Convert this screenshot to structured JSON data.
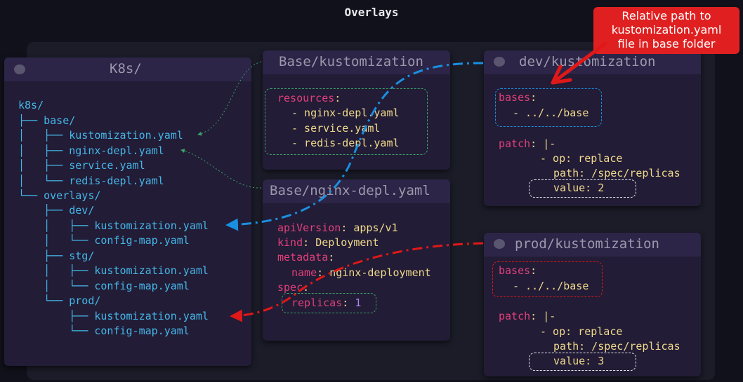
{
  "title": "Overlays",
  "callout": [
    "Relative path to",
    "kustomization.yaml",
    "file in base folder"
  ],
  "tree_panel": {
    "title": "K8s/",
    "lines": [
      "k8s/",
      "├── base/",
      "│   ├── kustomization.yaml",
      "│   ├── nginx-depl.yaml",
      "│   ├── service.yaml",
      "│   └── redis-depl.yaml",
      "└── overlays/",
      "    ├── dev/",
      "    │   ├── kustomization.yaml",
      "    │   └── config-map.yaml",
      "    ├── stg/",
      "    │   ├── kustomization.yaml",
      "    │   └── config-map.yaml",
      "    └── prod/",
      "        ├── kustomization.yaml",
      "        └── config-map.yaml"
    ]
  },
  "base_kustomization": {
    "title": "Base/kustomization",
    "key": "resources",
    "items": [
      "- nginx-depl.yaml",
      "- service.yaml",
      "- redis-depl.yaml"
    ]
  },
  "base_nginx": {
    "title": "Base/nginx-depl.yaml",
    "apiVersion_key": "apiVersion",
    "apiVersion_val": "apps/v1",
    "kind_key": "kind",
    "kind_val": "Deployment",
    "metadata_key": "metadata",
    "name_key": "name",
    "name_val": "nginx-deployment",
    "spec_key": "spec",
    "replicas_key": "replicas",
    "replicas_val": "1"
  },
  "dev_kustomization": {
    "title": "dev/kustomization",
    "bases_key": "bases",
    "bases_val": "- ../../base",
    "patch_key": "patch",
    "patch_pipe": "|-",
    "op_line": "- op: replace",
    "path_line": "path: /spec/replicas",
    "value_line": "value: 2"
  },
  "prod_kustomization": {
    "title": "prod/kustomization",
    "bases_key": "bases",
    "bases_val": "- ../../base",
    "patch_key": "patch",
    "patch_pipe": "|-",
    "op_line": "- op: replace",
    "path_line": "path: /spec/replicas",
    "value_line": "value: 3"
  },
  "colors": {
    "blue_arrow": "#1a8fe0",
    "red_arrow": "#e01818",
    "green_dash": "#3aa36a"
  }
}
